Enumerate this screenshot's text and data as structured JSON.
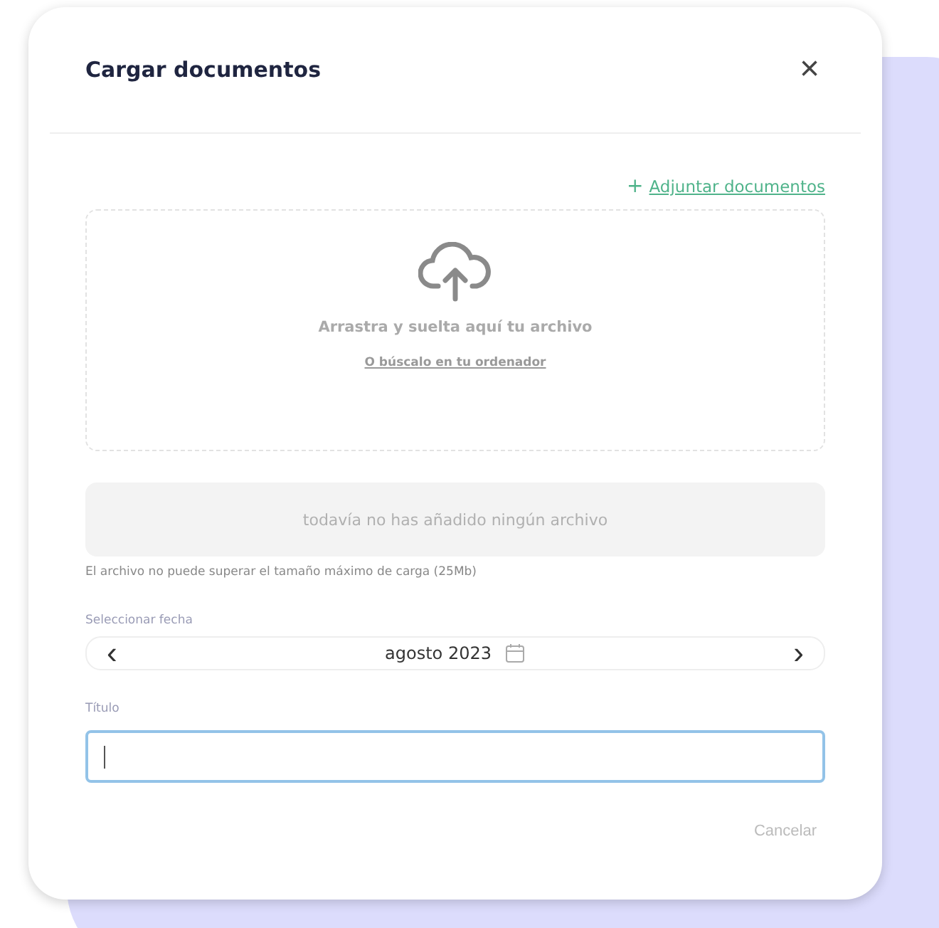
{
  "dialog": {
    "title": "Cargar documentos",
    "close": "×"
  },
  "attach_link": {
    "icon": "+",
    "label": "Adjuntar documentos"
  },
  "dropzone": {
    "message": "Arrastra y suelta aquí tu archivo",
    "browse_link": "O búscalo en tu ordenador"
  },
  "file_list": {
    "empty_message": "todavía no has añadido ningún archivo"
  },
  "size_note": "El archivo no puede superar el tamaño máximo de carga (25Mb)",
  "date_field": {
    "label": "Seleccionar fecha",
    "prev": "‹",
    "value": "agosto 2023",
    "next": "›"
  },
  "title_field": {
    "label": "Título",
    "focused": true
  },
  "buttons": [
    {
      "label": "Cancelar",
      "disabled": true
    }
  ]
}
